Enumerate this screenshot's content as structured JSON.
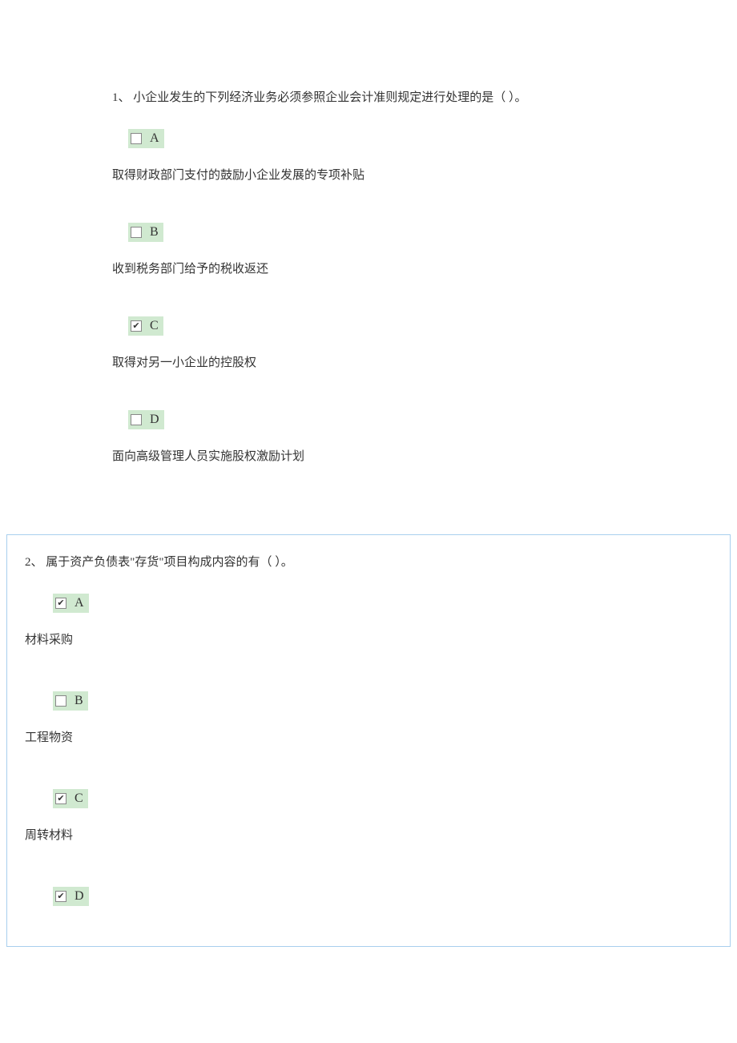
{
  "questions": [
    {
      "number": "1、",
      "text": "小企业发生的下列经济业务必须参照企业会计准则规定进行处理的是（  ）。",
      "options": [
        {
          "letter": "A",
          "checked": false,
          "text": "取得财政部门支付的鼓励小企业发展的专项补贴"
        },
        {
          "letter": "B",
          "checked": false,
          "text": "收到税务部门给予的税收返还"
        },
        {
          "letter": "C",
          "checked": true,
          "text": "取得对另一小企业的控股权"
        },
        {
          "letter": "D",
          "checked": false,
          "text": "面向高级管理人员实施股权激励计划"
        }
      ]
    },
    {
      "number": "2、",
      "text": "属于资产负债表\"存货\"项目构成内容的有（  ）。",
      "options": [
        {
          "letter": "A",
          "checked": true,
          "text": "材料采购"
        },
        {
          "letter": "B",
          "checked": false,
          "text": "工程物资"
        },
        {
          "letter": "C",
          "checked": true,
          "text": "周转材料"
        },
        {
          "letter": "D",
          "checked": true,
          "text": ""
        }
      ]
    }
  ]
}
